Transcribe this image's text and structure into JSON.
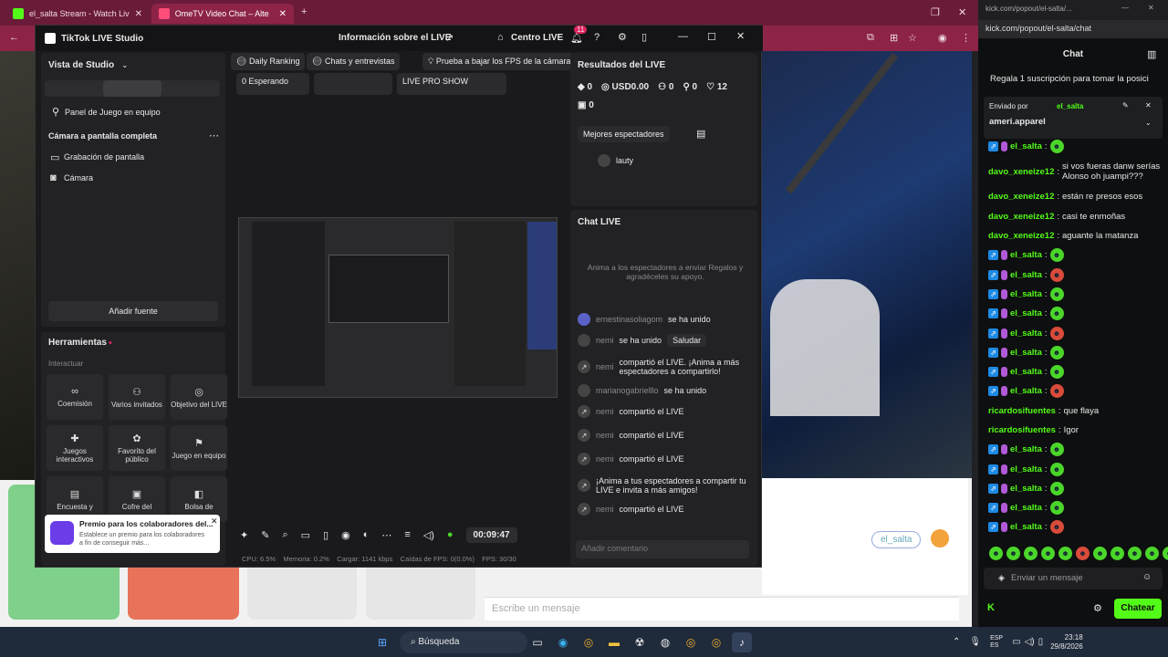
{
  "left_browser": {
    "tabs": [
      {
        "title": "el_salta Stream - Watch Live on",
        "active": false
      },
      {
        "title": "OmeTV Video Chat – Alte",
        "active": true
      }
    ],
    "new_tab": "+",
    "ome_input_placeholder": "Escribe un mensaje",
    "ome_badge": "el_salta"
  },
  "tiktok": {
    "app_title": "TikTok LIVE Studio",
    "live_info": "Información sobre el LIVE",
    "centro_live": "Centro LIVE",
    "notif_count": "11",
    "studio_view": "Vista de Studio",
    "panel_juego": "Panel de Juego en equipo",
    "scene_title": "Cámara a pantalla completa",
    "sources": [
      "Grabación de pantalla",
      "Cámara"
    ],
    "add_source": "Añadir fuente",
    "tools_title": "Herramientas",
    "interact": "Interactuar",
    "tools": [
      "Coemisión",
      "Varios invitados",
      "Objetivo del LIVE",
      "Juegos interactivos",
      "Favorito del público",
      "Juego en equipo",
      "Encuesta y",
      "Cofre del",
      "Bolsa de"
    ],
    "promo_title": "Premio para los colaboradores del...",
    "promo_text": "Establece un premio para los colaboradores a fin de conseguir más...",
    "chips": [
      "Daily Ranking",
      "Chats y entrevistas",
      "Prueba a bajar los FPS de la cámara"
    ],
    "waiting": "0 Esperando",
    "show_name": "LIVE PRO SHOW",
    "timer": "00:09:47",
    "stats": "CPU: 6.5%    Memoria: 0.2%    Cargar: 1141 kbps    Caídas de FPS: 0(0.0%)    FPS: 30/30",
    "results_title": "Resultados del LIVE",
    "results": [
      "0",
      "USD0.00",
      "0",
      "0",
      "12",
      "0"
    ],
    "best_viewers": "Mejores espectadores",
    "viewer_name": "lauty",
    "chat_title": "Chat LIVE",
    "chat_hint": "Anima a los espectadores a enviar Regalos y agradéceles su apoyo.",
    "chat": [
      {
        "user": "ernestinasoliagom",
        "text": "se ha unido"
      },
      {
        "user": "nemi",
        "text": "se ha unido",
        "button": "Saludar"
      },
      {
        "user": "nemi",
        "text": "compartió el LIVE. ¡Anima a más espectadores a compartirlo!"
      },
      {
        "user": "marianogabrielllo",
        "text": "se ha unido"
      },
      {
        "user": "nemi",
        "text": "compartió el LIVE"
      },
      {
        "user": "nemi",
        "text": "compartió el LIVE"
      },
      {
        "user": "nemi",
        "text": "compartió el LIVE"
      },
      {
        "user": "",
        "text": "¡Anima a tus espectadores a compartir tu LIVE e invita a más amigos!"
      },
      {
        "user": "nemi",
        "text": "compartió el LIVE"
      }
    ],
    "comment_placeholder": "Añadir comentario"
  },
  "kick": {
    "url": "kick.com/popout/el-salta/...",
    "url2": "kick.com/popout/el-salta/chat",
    "header": "Chat",
    "pinned_top": "Regala 1 suscripción para tomar la posici",
    "pinned_by_label": "Enviado por",
    "pinned_by_user": "el_salta",
    "pinned_msg": "ameri.apparel",
    "messages": [
      {
        "user": "el_salta",
        "emote": true,
        "red": false
      },
      {
        "user": "davo_xeneize12",
        "text": "si vos fueras danw serías Alonso oh juampi???"
      },
      {
        "user": "davo_xeneize12",
        "text": "están re presos esos"
      },
      {
        "user": "davo_xeneize12",
        "text": "casi te enmoñas"
      },
      {
        "user": "davo_xeneize12",
        "text": "aguante la matanza"
      },
      {
        "user": "el_salta",
        "emote": true,
        "red": false
      },
      {
        "user": "el_salta",
        "emote": true,
        "red": true
      },
      {
        "user": "el_salta",
        "emote": true,
        "red": false
      },
      {
        "user": "el_salta",
        "emote": true,
        "red": false
      },
      {
        "user": "el_salta",
        "emote": true,
        "red": true
      },
      {
        "user": "el_salta",
        "emote": true,
        "red": false
      },
      {
        "user": "el_salta",
        "emote": true,
        "red": false
      },
      {
        "user": "el_salta",
        "emote": true,
        "red": true
      },
      {
        "user": "ricardosifuentes",
        "text": "que flaya"
      },
      {
        "user": "ricardosifuentes",
        "text": "Igor"
      },
      {
        "user": "el_salta",
        "emote": true,
        "red": false
      },
      {
        "user": "el_salta",
        "emote": true,
        "red": false
      },
      {
        "user": "el_salta",
        "emote": true,
        "red": false
      },
      {
        "user": "el_salta",
        "emote": true,
        "red": false
      },
      {
        "user": "el_salta",
        "emote": true,
        "red": true
      }
    ],
    "input_placeholder": "Enviar un mensaje",
    "send_button": "Chatear"
  },
  "taskbar": {
    "search": "Búsqueda",
    "lang": "ESP\nES",
    "time": "23:18",
    "date": "29/8/2026"
  }
}
